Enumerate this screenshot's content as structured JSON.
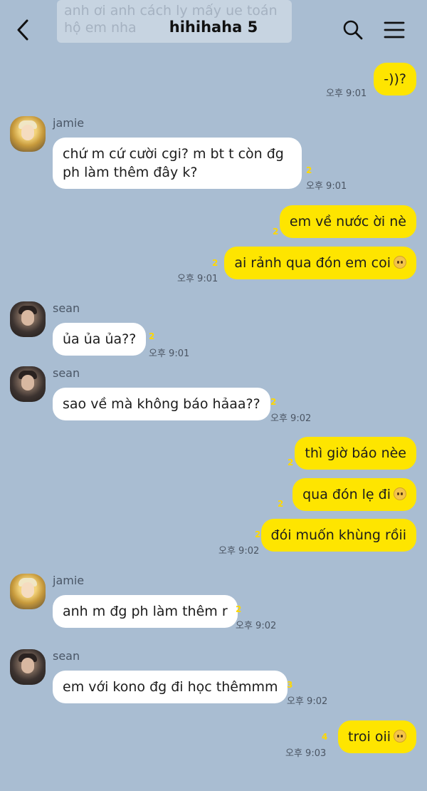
{
  "header": {
    "title": "hihihaha 5",
    "ghost_text": "anh ơi anh cách ly mấy ue toán hộ em nha"
  },
  "messages": [
    {
      "id": "m1",
      "text": "-))?",
      "time": "오후 9:01"
    },
    {
      "id": "m2",
      "sender": "jamie",
      "line1": "chứ m cứ cười cgi? m bt t còn đg",
      "line2": "ph làm thêm đây k?",
      "count": "2",
      "time": "오후 9:01"
    },
    {
      "id": "m3",
      "text": "em về nước ời nè",
      "count": "2"
    },
    {
      "id": "m4",
      "text": "ai rảnh qua đón em coi",
      "count": "2",
      "time": "오후 9:01",
      "emoji": "pleading-face-emoji"
    },
    {
      "id": "m5",
      "sender": "sean",
      "text": "ủa ủa ủa??",
      "count": "2",
      "time": "오후 9:01"
    },
    {
      "id": "m6",
      "sender": "sean",
      "text": "sao về mà không báo hảaa??",
      "count": "2",
      "time": "오후 9:02"
    },
    {
      "id": "m7",
      "text": "thì giờ báo nèe",
      "count": "2"
    },
    {
      "id": "m8",
      "text": "qua đón lẹ đi",
      "count": "2",
      "emoji": "crying-face-emoji"
    },
    {
      "id": "m9",
      "text": "đói muốn khùng rồii",
      "count": "2",
      "time": "오후 9:02"
    },
    {
      "id": "m10",
      "sender": "jamie",
      "text": "anh m đg ph làm thêm r",
      "count": "2",
      "time": "오후 9:02"
    },
    {
      "id": "m11",
      "sender": "sean",
      "text": "em với kono đg đi học thêmmm",
      "count": "3",
      "time": "오후 9:02"
    },
    {
      "id": "m12",
      "text": "troi oii",
      "count": "4",
      "time": "오후 9:03",
      "emoji": "sad-face-emoji"
    }
  ],
  "colors": {
    "background": "#a9bdd2",
    "incoming_bubble": "#ffffff",
    "outgoing_bubble": "#fee500",
    "unread_count": "#ffd800"
  },
  "icons": [
    "back-arrow-icon",
    "search-icon",
    "menu-icon"
  ]
}
